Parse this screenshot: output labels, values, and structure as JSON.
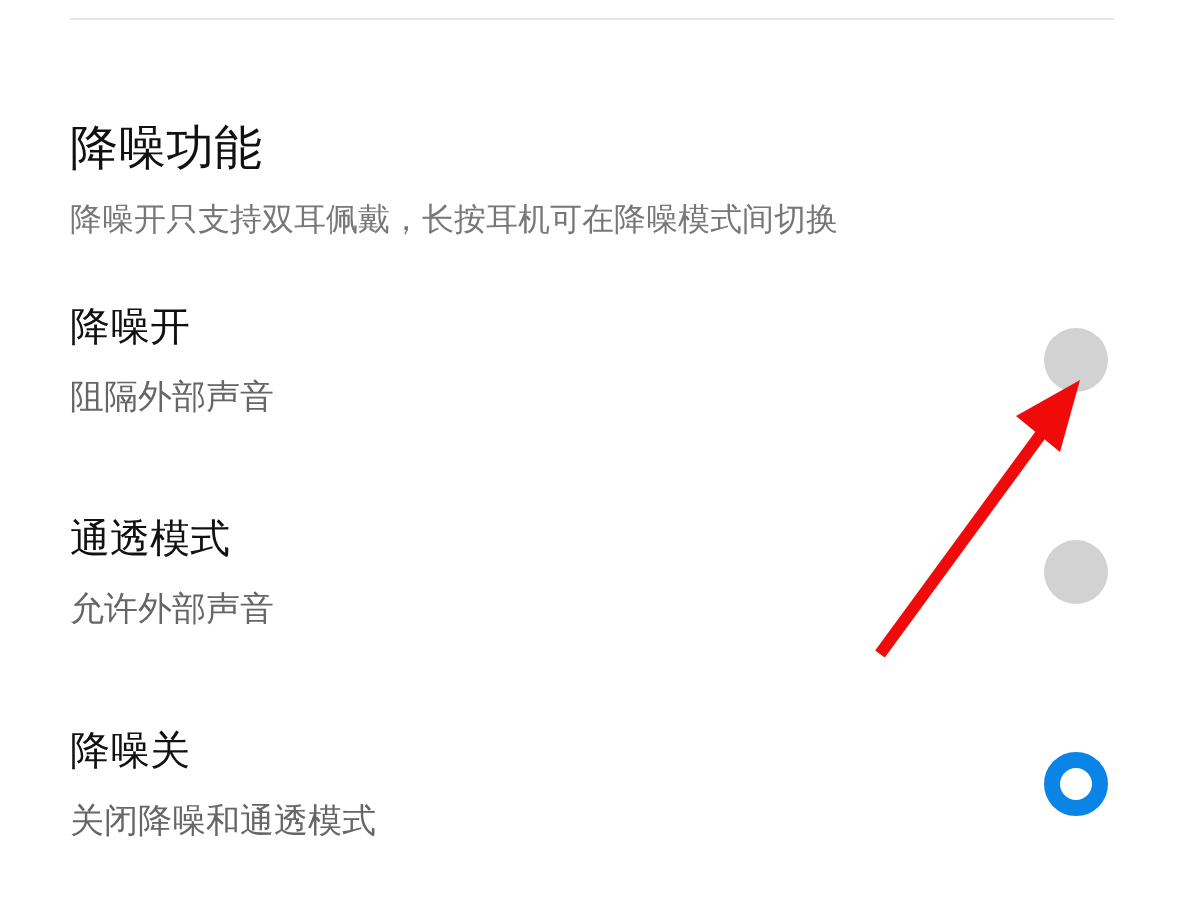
{
  "section": {
    "title": "降噪功能",
    "description": "降噪开只支持双耳佩戴，长按耳机可在降噪模式间切换"
  },
  "options": [
    {
      "label": "降噪开",
      "description": "阻隔外部声音",
      "selected": false
    },
    {
      "label": "通透模式",
      "description": "允许外部声音",
      "selected": false
    },
    {
      "label": "降噪关",
      "description": "关闭降噪和通透模式",
      "selected": true
    }
  ]
}
